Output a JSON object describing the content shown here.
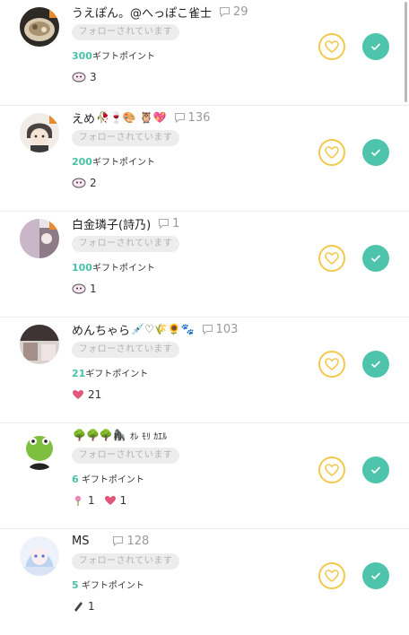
{
  "rows": [
    {
      "name": "うえぽん。@へっぽこ雀士",
      "comment_count": "29",
      "follow_status": "フォローされています",
      "gift_points": "300",
      "gift_label": "ギフトポイント",
      "reactions": [
        {
          "icon": "ghost-sticker-icon",
          "count": "3"
        }
      ]
    },
    {
      "name": "えめ",
      "name_emoji": "🥀🍷🎨 🦉💖",
      "comment_count": "136",
      "follow_status": "フォローされています",
      "gift_points": "200",
      "gift_label": "ギフトポイント",
      "reactions": [
        {
          "icon": "ghost-sticker-icon",
          "count": "2"
        }
      ]
    },
    {
      "name": "白金璘子(詩乃)",
      "comment_count": "1",
      "follow_status": "フォローされています",
      "gift_points": "100",
      "gift_label": "ギフトポイント",
      "reactions": [
        {
          "icon": "ghost-sticker-icon",
          "count": "1"
        }
      ]
    },
    {
      "name": "めんちゃら",
      "name_emoji": "💉♡🌾🌻🐾",
      "comment_count": "103",
      "follow_status": "フォローされています",
      "gift_points": "21",
      "gift_label": "ギフトポイント",
      "reactions": [
        {
          "icon": "heart-sticker-icon",
          "count": "21"
        }
      ]
    },
    {
      "name": "",
      "name_emoji": "🌳🌳🌳🦍",
      "name_suffix": "ｵﾚ ﾓﾘ ｶｴﾙ",
      "comment_count": "",
      "follow_status": "フォローされています",
      "gift_points": "6",
      "gift_label": "ギフトポイント",
      "reactions": [
        {
          "icon": "flower-sticker-icon",
          "count": "1"
        },
        {
          "icon": "heart-sticker-icon",
          "count": "1"
        }
      ]
    },
    {
      "name": "MS",
      "comment_count": "128",
      "follow_status": "フォローされています",
      "gift_points": "5",
      "gift_label": "ギフトポイント",
      "reactions": [
        {
          "icon": "pen-sticker-icon",
          "count": "1"
        }
      ]
    }
  ],
  "colors": {
    "accent_green": "#4fc4ac",
    "heart_outline": "#f2c94c",
    "pill_bg": "#ededed",
    "gift_number": "#49c1a8"
  }
}
